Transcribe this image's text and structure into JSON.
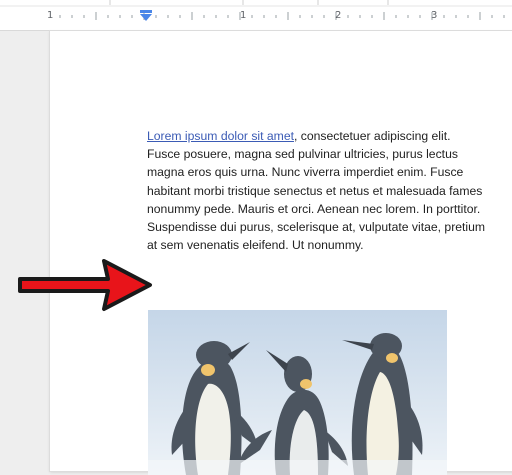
{
  "ruler": {
    "numbers": [
      "1",
      "1",
      "2",
      "3"
    ],
    "indent_marker": "first-line-indent-marker"
  },
  "document": {
    "link_text": "Lorem ipsum dolor sit amet",
    "first_line_rest": ", consectetuer adipiscing elit.",
    "lines": [
      "Fusce posuere, magna sed pulvinar ultricies, purus lectus",
      "magna eros quis urna. Nunc viverra imperdiet enim. Fusce",
      "habitant morbi tristique senectus et netus et malesuada fames",
      "nonummy pede. Mauris et orci. Aenean nec lorem. In porttitor.",
      "Suspendisse dui purus, scelerisque at, vulputate vitae, pretium",
      "at sem venenatis eleifend. Ut nonummy."
    ]
  },
  "image": {
    "name": "penguins-image"
  },
  "annotation": {
    "icon": "red-arrow-icon",
    "color": "#e8141a"
  },
  "colors": {
    "link": "#3b5bb5",
    "text": "#222222",
    "ruler_marker": "#4a86e8"
  }
}
